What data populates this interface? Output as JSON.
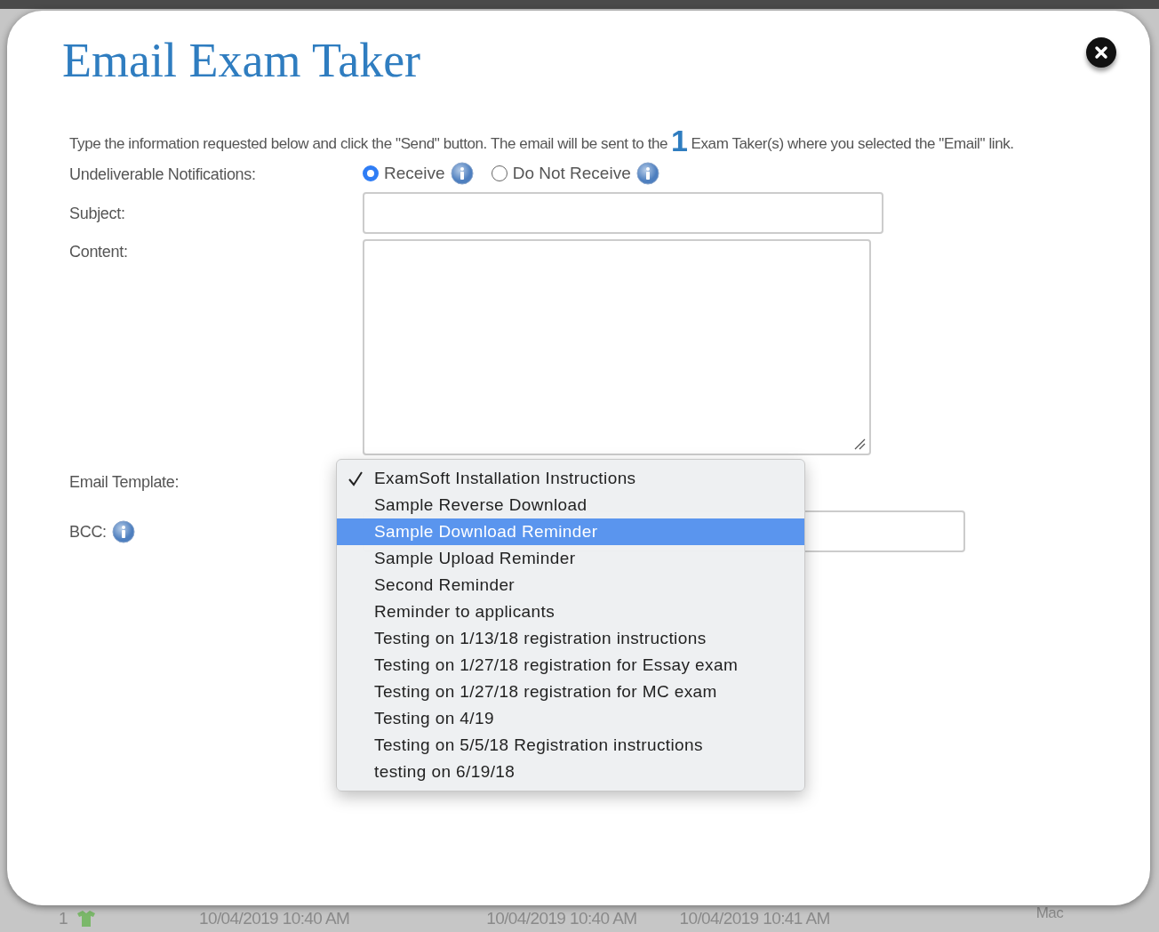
{
  "dialog": {
    "title": "Email Exam Taker",
    "intro": {
      "before": "Type the information requested below and click the \"Send\" button. The email will be sent to the",
      "count": "1",
      "after": "Exam Taker(s) where you selected the \"Email\" link."
    },
    "undeliverable": {
      "label": "Undeliverable Notifications:",
      "options": [
        {
          "label": "Receive",
          "selected": true
        },
        {
          "label": "Do Not Receive",
          "selected": false
        }
      ]
    },
    "subject": {
      "label": "Subject:"
    },
    "content": {
      "label": "Content:"
    },
    "email_template": {
      "label": "Email Template:",
      "menu": [
        {
          "label": "ExamSoft Installation Instructions",
          "checked": true,
          "selected": false
        },
        {
          "label": "Sample Reverse Download",
          "checked": false,
          "selected": false
        },
        {
          "label": "Sample Download Reminder",
          "checked": false,
          "selected": true
        },
        {
          "label": "Sample Upload Reminder",
          "checked": false,
          "selected": false
        },
        {
          "label": "Second Reminder",
          "checked": false,
          "selected": false
        },
        {
          "label": "Reminder to applicants",
          "checked": false,
          "selected": false
        },
        {
          "label": "Testing on 1/13/18 registration instructions",
          "checked": false,
          "selected": false
        },
        {
          "label": "Testing on 1/27/18 registration for Essay exam",
          "checked": false,
          "selected": false
        },
        {
          "label": "Testing on 1/27/18 registration for MC exam",
          "checked": false,
          "selected": false
        },
        {
          "label": "Testing on 4/19",
          "checked": false,
          "selected": false
        },
        {
          "label": "Testing on 5/5/18 Registration instructions",
          "checked": false,
          "selected": false
        },
        {
          "label": "testing on 6/19/18",
          "checked": false,
          "selected": false
        }
      ]
    },
    "bcc": {
      "label": "BCC:"
    }
  },
  "background_row": {
    "number": "1",
    "dates": [
      "10/04/2019 10:40 AM",
      "10/04/2019 10:40 AM",
      "10/04/2019 10:41 AM"
    ],
    "platform": "Mac"
  }
}
